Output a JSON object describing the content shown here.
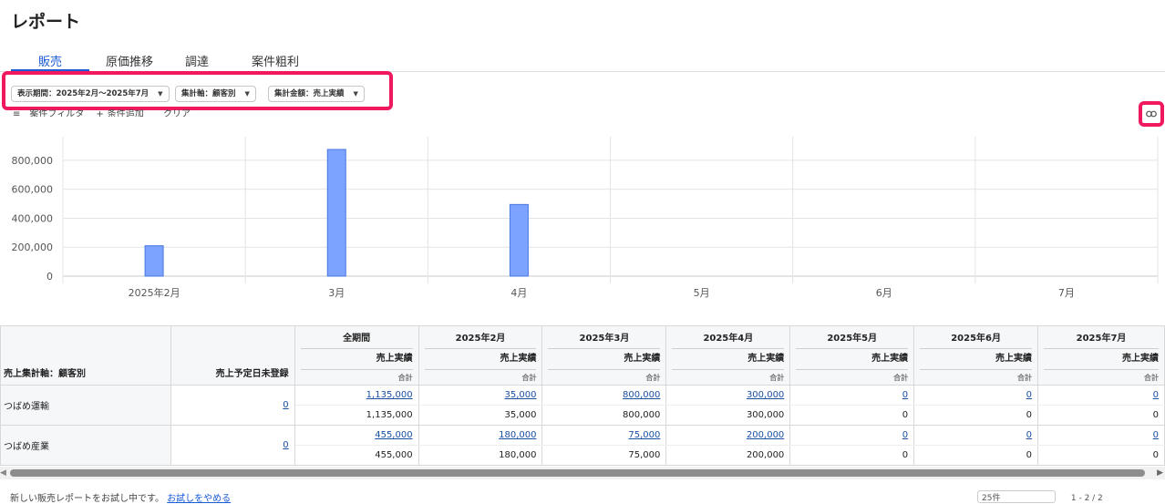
{
  "page": {
    "title": "レポート"
  },
  "tabs": [
    {
      "label": "販売",
      "active": true
    },
    {
      "label": "原価推移",
      "active": false
    },
    {
      "label": "調達",
      "active": false
    },
    {
      "label": "案件粗利",
      "active": false
    }
  ],
  "filters": {
    "period": "表示期間：2025年2月～2025年7月",
    "axis": "集計軸：顧客別",
    "amount": "集計金額：売上実績",
    "case_filter": "案件フィルタ",
    "add_condition": "条件追加",
    "clear": "クリア"
  },
  "colors": {
    "accent": "#1a5bd6",
    "highlight": "#f0195e",
    "bar": "#7ba3ff",
    "bar_border": "#4a78e0"
  },
  "chart_data": {
    "type": "bar",
    "categories": [
      "2025年2月",
      "3月",
      "4月",
      "5月",
      "6月",
      "7月"
    ],
    "values": [
      210000,
      875000,
      495000,
      0,
      0,
      0
    ],
    "yticks": [
      0,
      200000,
      400000,
      600000,
      800000
    ],
    "ytick_labels": [
      "0",
      "200,000",
      "400,000",
      "600,000",
      "800,000"
    ],
    "ylim": [
      0,
      900000
    ],
    "grid": true
  },
  "table": {
    "row_header": "売上集計軸：顧客別",
    "plan_header": "売上予定日未登録",
    "metric_label": "売上実績",
    "sub_label": "合計",
    "columns": [
      "全期間",
      "2025年2月",
      "2025年3月",
      "2025年4月",
      "2025年5月",
      "2025年6月",
      "2025年7月"
    ],
    "rows": [
      {
        "name": "つばめ運輸",
        "plan": "0",
        "values": [
          "1,135,000",
          "35,000",
          "800,000",
          "300,000",
          "0",
          "0",
          "0"
        ],
        "totals": [
          "1,135,000",
          "35,000",
          "800,000",
          "300,000",
          "0",
          "0",
          "0"
        ]
      },
      {
        "name": "つばめ産業",
        "plan": "0",
        "values": [
          "455,000",
          "180,000",
          "75,000",
          "200,000",
          "0",
          "0",
          "0"
        ],
        "totals": [
          "455,000",
          "180,000",
          "75,000",
          "200,000",
          "0",
          "0",
          "0"
        ]
      }
    ]
  },
  "footer": {
    "notice": "新しい販売レポートをお試し中です。",
    "link": "お試しをやめる"
  },
  "pager": {
    "per_page": "25件",
    "range": "1 - 2 / 2"
  }
}
